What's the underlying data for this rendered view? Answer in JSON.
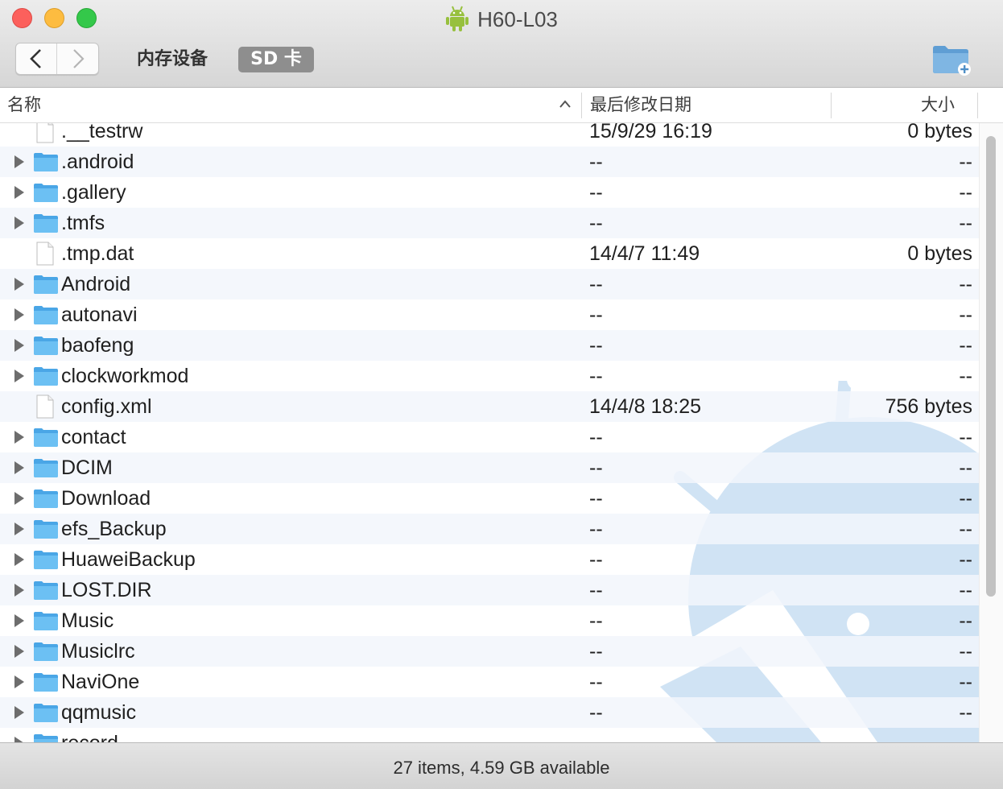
{
  "window": {
    "title": "H60-L03"
  },
  "toolbar": {
    "internal_storage": "内存设备",
    "sd_card": "SD 卡"
  },
  "columns": {
    "name": "名称",
    "modified": "最后修改日期",
    "size": "大小"
  },
  "rows": [
    {
      "type": "file",
      "name": ".__testrw",
      "date": "15/9/29 16:19",
      "size": "0 bytes"
    },
    {
      "type": "folder",
      "name": ".android",
      "date": "--",
      "size": "--"
    },
    {
      "type": "folder",
      "name": ".gallery",
      "date": "--",
      "size": "--"
    },
    {
      "type": "folder",
      "name": ".tmfs",
      "date": "--",
      "size": "--"
    },
    {
      "type": "file",
      "name": ".tmp.dat",
      "date": "14/4/7 11:49",
      "size": "0 bytes"
    },
    {
      "type": "folder",
      "name": "Android",
      "date": "--",
      "size": "--"
    },
    {
      "type": "folder",
      "name": "autonavi",
      "date": "--",
      "size": "--"
    },
    {
      "type": "folder",
      "name": "baofeng",
      "date": "--",
      "size": "--"
    },
    {
      "type": "folder",
      "name": "clockworkmod",
      "date": "--",
      "size": "--"
    },
    {
      "type": "file",
      "name": "config.xml",
      "date": "14/4/8 18:25",
      "size": "756 bytes"
    },
    {
      "type": "folder",
      "name": "contact",
      "date": "--",
      "size": "--"
    },
    {
      "type": "folder",
      "name": "DCIM",
      "date": "--",
      "size": "--"
    },
    {
      "type": "folder",
      "name": "Download",
      "date": "--",
      "size": "--"
    },
    {
      "type": "folder",
      "name": "efs_Backup",
      "date": "--",
      "size": "--"
    },
    {
      "type": "folder",
      "name": "HuaweiBackup",
      "date": "--",
      "size": "--"
    },
    {
      "type": "folder",
      "name": "LOST.DIR",
      "date": "--",
      "size": "--"
    },
    {
      "type": "folder",
      "name": "Music",
      "date": "--",
      "size": "--"
    },
    {
      "type": "folder",
      "name": "Musiclrc",
      "date": "--",
      "size": "--"
    },
    {
      "type": "folder",
      "name": "NaviOne",
      "date": "--",
      "size": "--"
    },
    {
      "type": "folder",
      "name": "qqmusic",
      "date": "--",
      "size": "--"
    },
    {
      "type": "folder",
      "name": "record",
      "date": "",
      "size": ""
    }
  ],
  "status": {
    "text": "27 items, 4.59 GB available"
  },
  "icons": {
    "app": "android-icon",
    "back": "chevron-left-icon",
    "forward": "chevron-right-icon",
    "new_folder": "new-folder-icon",
    "folder": "folder-icon",
    "file": "file-icon",
    "disclosure": "disclosure-triangle-icon",
    "sort": "sort-ascending-icon"
  },
  "colors": {
    "close": "#fc605c",
    "minimize": "#fdbc40",
    "maximize": "#34c84a",
    "folder": "#5ab5ef",
    "android": "#97c03d",
    "watermark": "#d0e3f4"
  }
}
